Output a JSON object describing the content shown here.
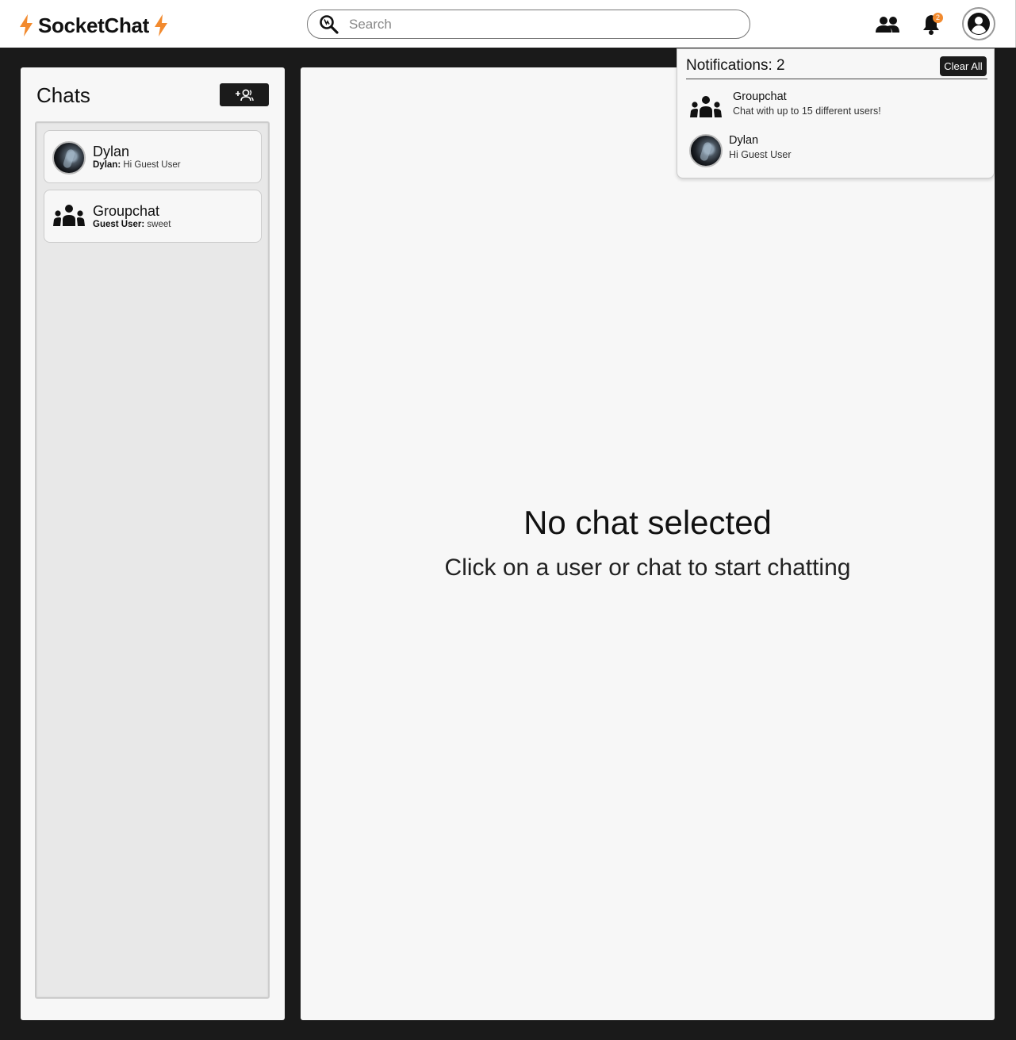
{
  "app": {
    "name": "SocketChat",
    "accent_color": "#f28a2e"
  },
  "header": {
    "search_placeholder": "Search",
    "notification_count": "2",
    "icons": [
      "search-icon",
      "users-icon",
      "bell-icon",
      "profile-icon"
    ]
  },
  "sidebar": {
    "title": "Chats",
    "new_group_icon": "add-group-icon",
    "chats": [
      {
        "name": "Dylan",
        "sender": "Dylan:",
        "message": "Hi Guest User",
        "avatar": "photo"
      },
      {
        "name": "Groupchat",
        "sender": "Guest User:",
        "message": "sweet",
        "avatar": "group-icon"
      }
    ]
  },
  "main": {
    "empty_title": "No chat selected",
    "empty_subtitle": "Click on a user or chat to start chatting"
  },
  "notifications": {
    "title": "Notifications: 2",
    "clear_label": "Clear All",
    "items": [
      {
        "title": "Groupchat",
        "body": "Chat with up to 15 different users!",
        "icon": "group-icon"
      },
      {
        "title": "Dylan",
        "body": "Hi Guest User",
        "icon": "photo"
      }
    ]
  }
}
